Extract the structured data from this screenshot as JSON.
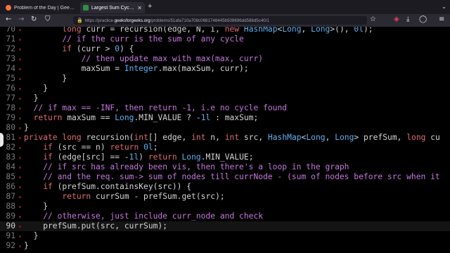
{
  "browser": {
    "tabs": [
      {
        "title": "Problem of the Day | GeeksforGeeks",
        "active": false
      },
      {
        "title": "Largest Sum Cycle | Practice | G...",
        "active": true
      }
    ],
    "url_prefix": "https://practice.",
    "url_domain": "geeksforgeeks.org",
    "url_rest": "/problems/51afa710a708c0681748445b509696dd588d5c40/1"
  },
  "code": {
    "lines": [
      {
        "n": "70",
        "text": "        long curr = recursion(edge, N, i, new HashMap<Long, Long>(), 0l);",
        "kind": "plain"
      },
      {
        "n": "71",
        "text": "        // if the curr is the sum of any cycle",
        "kind": "comment"
      },
      {
        "n": "72",
        "text": "        if (curr > 0) {",
        "kind": "plain"
      },
      {
        "n": "73",
        "text": "            // then update max with max(max, curr)",
        "kind": "comment"
      },
      {
        "n": "74",
        "text": "            maxSum = Integer.max(maxSum, curr);",
        "kind": "plain"
      },
      {
        "n": "75",
        "text": "        }",
        "kind": "plain"
      },
      {
        "n": "76",
        "text": "    }",
        "kind": "plain"
      },
      {
        "n": "77",
        "text": "  }",
        "kind": "plain"
      },
      {
        "n": "78",
        "text": "  // if max == -INF, then return -1, i.e no cycle found",
        "kind": "comment"
      },
      {
        "n": "79",
        "text": "  return maxSum == Long.MIN_VALUE ? -1l : maxSum;",
        "kind": "plain"
      },
      {
        "n": "80",
        "text": "}",
        "kind": "plain"
      },
      {
        "n": "81",
        "text": "private long recursion(int[] edge, int n, int src, HashMap<Long, Long> prefSum, long cu",
        "kind": "plain"
      },
      {
        "n": "82",
        "text": "    if (src == n) return 0l;",
        "kind": "plain"
      },
      {
        "n": "83",
        "text": "    if (edge[src] == -1l) return Long.MIN_VALUE;",
        "kind": "plain"
      },
      {
        "n": "84",
        "text": "    // if src has already been vis, then there's a loop in the graph",
        "kind": "comment"
      },
      {
        "n": "85",
        "text": "    // and the req. sum-> sum of nodes till currNode - (sum of nodes before src when it",
        "kind": "comment"
      },
      {
        "n": "86",
        "text": "    if (prefSum.containsKey(src)) {",
        "kind": "plain"
      },
      {
        "n": "87",
        "text": "        return currSum - prefSum.get(src);",
        "kind": "plain"
      },
      {
        "n": "88",
        "text": "    }",
        "kind": "plain"
      },
      {
        "n": "89",
        "text": "    // otherwise, just include curr_node and check",
        "kind": "comment"
      },
      {
        "n": "90",
        "text": "    prefSum.put(src, currSum);",
        "kind": "plain",
        "current": true
      },
      {
        "n": "91",
        "text": "  }",
        "kind": "plain"
      },
      {
        "n": "92",
        "text": "}",
        "kind": "plain"
      }
    ]
  }
}
